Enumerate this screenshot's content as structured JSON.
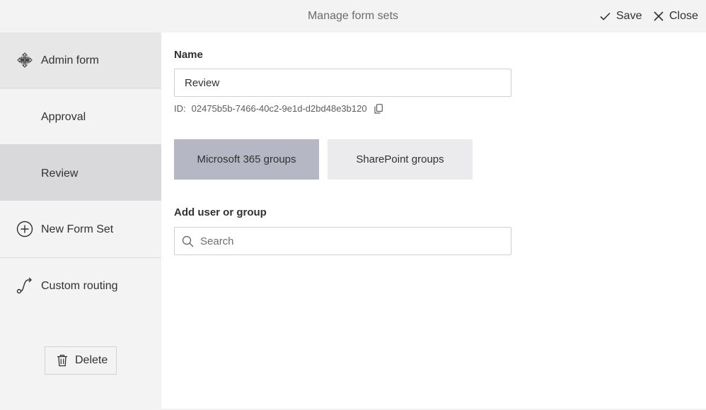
{
  "header": {
    "title": "Manage form sets",
    "save_label": "Save",
    "close_label": "Close"
  },
  "sidebar": {
    "items": [
      {
        "label": "Admin form",
        "icon": "move-icon"
      },
      {
        "label": "Approval"
      },
      {
        "label": "Review",
        "selected": true
      },
      {
        "label": "New Form Set",
        "icon": "add-circle-icon"
      },
      {
        "label": "Custom routing",
        "icon": "route-icon"
      }
    ],
    "delete_label": "Delete"
  },
  "form": {
    "name_label": "Name",
    "name_value": "Review",
    "id_prefix": "ID:",
    "id_value": "02475b5b-7466-40c2-9e1d-d2bd48e3b120",
    "groups": {
      "microsoft_label": "Microsoft 365 groups",
      "sharepoint_label": "SharePoint groups",
      "active_color": "#b5b8c4",
      "inactive_color": "#ebebed"
    },
    "add_label": "Add user or group",
    "search_placeholder": "Search"
  }
}
